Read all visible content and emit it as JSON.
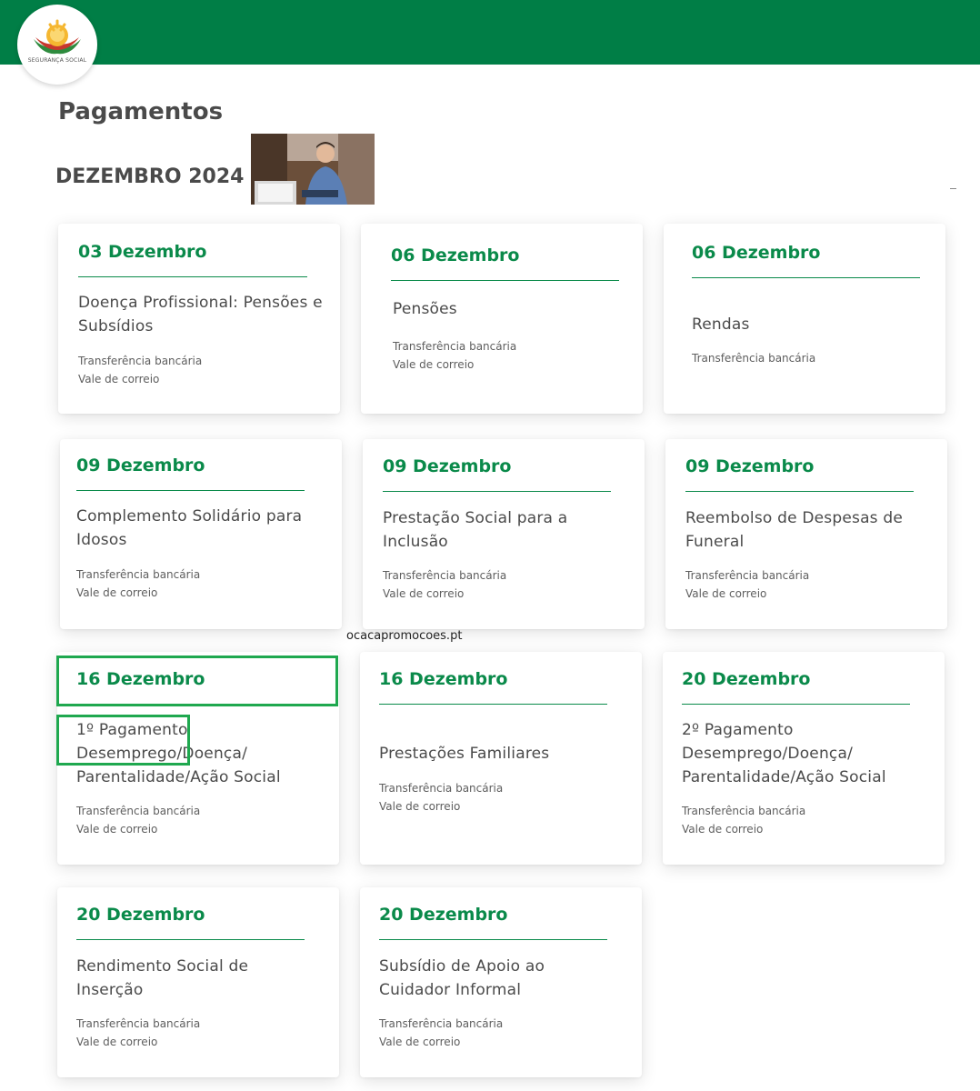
{
  "header": {
    "logo_text": "SEGURANÇA SOCIAL"
  },
  "page": {
    "title": "Pagamentos",
    "month": "DEZEMBRO 2024",
    "watermark": "ocacapromocoes.pt"
  },
  "colors": {
    "topbar": "#007e46",
    "accent": "#0a8a4a",
    "highlight": "#1fa84f"
  },
  "cards": [
    {
      "date": "03 Dezembro",
      "title": "Doença Profissional: Pensões e Subsídios",
      "methods": [
        "Transferência bancária",
        "Vale de correio"
      ]
    },
    {
      "date": "06 Dezembro",
      "title": "Pensões",
      "methods": [
        "Transferência bancária",
        "Vale de correio"
      ]
    },
    {
      "date": "06 Dezembro",
      "title": "Rendas",
      "methods": [
        "Transferência bancária"
      ]
    },
    {
      "date": "09 Dezembro",
      "title": "Complemento Solidário para Idosos",
      "methods": [
        "Transferência bancária",
        "Vale de correio"
      ]
    },
    {
      "date": "09 Dezembro",
      "title": "Prestação Social para a Inclusão",
      "methods": [
        "Transferência bancária",
        "Vale de correio"
      ]
    },
    {
      "date": "09 Dezembro",
      "title": "Reembolso de Despesas de Funeral",
      "methods": [
        "Transferência bancária",
        "Vale de correio"
      ]
    },
    {
      "date": "16 Dezembro",
      "title": "1º Pagamento Desemprego/Doença/ Parentalidade/Ação Social",
      "methods": [
        "Transferência bancária",
        "Vale de correio"
      ]
    },
    {
      "date": "16 Dezembro",
      "title": "Prestações Familiares",
      "methods": [
        "Transferência bancária",
        "Vale de correio"
      ]
    },
    {
      "date": "20 Dezembro",
      "title": "2º Pagamento Desemprego/Doença/ Parentalidade/Ação Social",
      "methods": [
        "Transferência bancária",
        "Vale de correio"
      ]
    },
    {
      "date": "20 Dezembro",
      "title": "Rendimento Social de Inserção",
      "methods": [
        "Transferência bancária",
        "Vale de correio"
      ]
    },
    {
      "date": "20 Dezembro",
      "title": "Subsídio de Apoio ao Cuidador Informal",
      "methods": [
        "Transferência bancária",
        "Vale de correio"
      ]
    }
  ]
}
